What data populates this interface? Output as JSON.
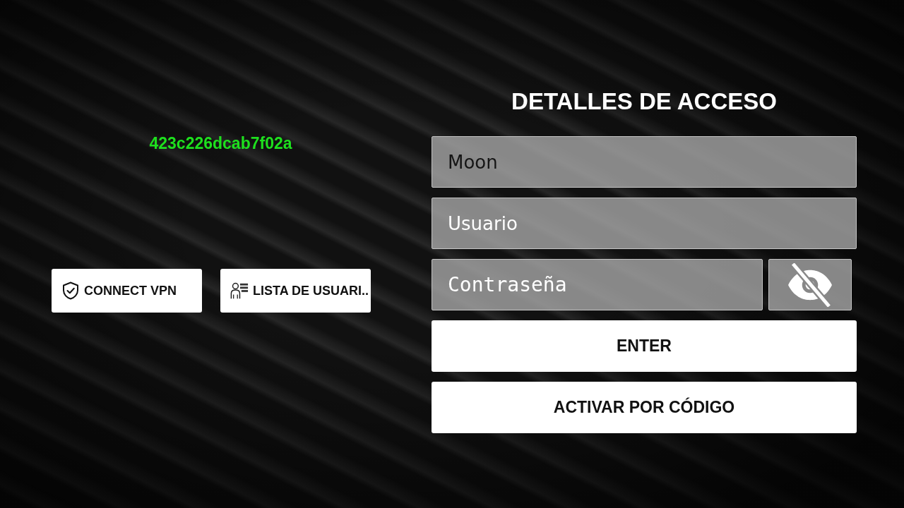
{
  "device_id": "423c226dcab7f02a",
  "actions": [
    {
      "kind": "vpn",
      "label": "CONNECT VPN"
    },
    {
      "kind": "users",
      "label": "LISTA DE USUARI.."
    }
  ],
  "login": {
    "title": "DETALLES DE ACCESO",
    "fields": [
      {
        "kind": "text",
        "value": "Moon"
      },
      {
        "kind": "text",
        "placeholder": "Usuario"
      },
      {
        "kind": "password",
        "placeholder": "Contraseña",
        "visible": false
      }
    ],
    "buttons": [
      "ENTER",
      "ACTIVAR POR CÓDIGO"
    ]
  }
}
